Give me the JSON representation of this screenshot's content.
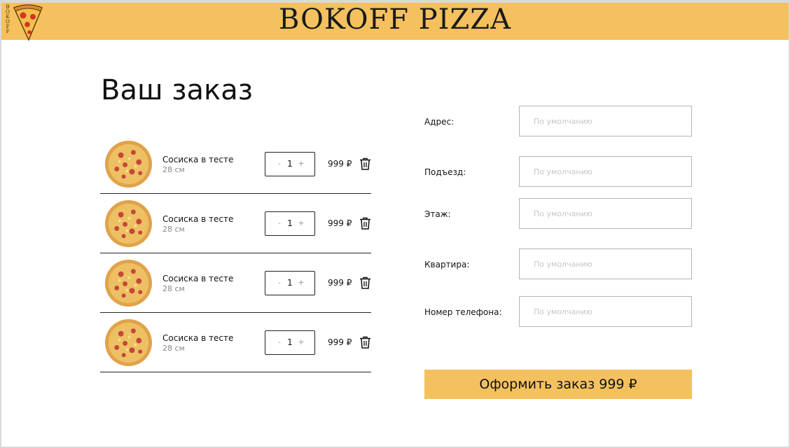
{
  "header": {
    "brand": "BOKOFF PIZZA",
    "logo_letters": [
      "B",
      "O",
      "K",
      "O",
      "F",
      "F"
    ],
    "logo_icon": "pizza-slice-icon"
  },
  "page": {
    "title": "Ваш заказ"
  },
  "cart": {
    "items": [
      {
        "name": "Сосиска в тесте",
        "size": "28 см",
        "minus": "-",
        "quantity": "1",
        "plus": "+",
        "price": "999 ₽"
      },
      {
        "name": "Сосиска в тесте",
        "size": "28 см",
        "minus": "-",
        "quantity": "1",
        "plus": "+",
        "price": "999 ₽"
      },
      {
        "name": "Сосиска в тесте",
        "size": "28 см",
        "minus": "-",
        "quantity": "1",
        "plus": "+",
        "price": "999 ₽"
      },
      {
        "name": "Сосиска в тесте",
        "size": "28 см",
        "minus": "-",
        "quantity": "1",
        "plus": "+",
        "price": "999 ₽"
      }
    ]
  },
  "form": {
    "fields": [
      {
        "label": "Адрес:",
        "placeholder": "По умолчанию",
        "value": ""
      },
      {
        "label": "Подъезд:",
        "placeholder": "По умолчанию",
        "value": ""
      },
      {
        "label": "Этаж:",
        "placeholder": "По умолчанию",
        "value": ""
      },
      {
        "label": "Квартира:",
        "placeholder": "По умолчанию",
        "value": ""
      },
      {
        "label": "Номер телефона:",
        "placeholder": "По умолчанию",
        "value": ""
      }
    ],
    "submit_label": "Оформить заказ 999 ₽"
  },
  "colors": {
    "accent": "#f4c15e",
    "text": "#111111",
    "muted": "#8a8a8a",
    "placeholder": "#c6c6c6"
  },
  "icons": {
    "pizza": "pizza-icon",
    "trash": "trash-icon"
  }
}
